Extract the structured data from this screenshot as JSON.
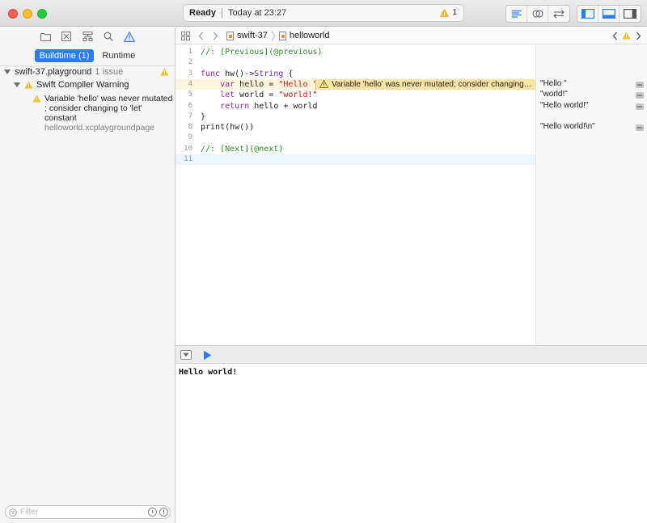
{
  "window": {
    "status": {
      "state": "Ready",
      "time": "Today at 23:27",
      "warning_count": "1"
    },
    "toolbar": {
      "editor_modes": [
        "standard-editor-icon",
        "assistant-editor-icon",
        "version-editor-icon"
      ],
      "view_toggles": [
        "navigator-toggle-icon",
        "debug-area-toggle-icon",
        "utilities-toggle-icon"
      ]
    }
  },
  "navigator": {
    "icons": [
      "folder-icon",
      "symbol-icon",
      "hierarchy-icon",
      "search-icon",
      "issue-warning-icon"
    ],
    "tabs": {
      "buildtime": "Buildtime (1)",
      "runtime": "Runtime"
    },
    "tree": {
      "project": "swift-37.playground",
      "project_count": "1 issue",
      "group": "Swift Compiler Warning",
      "issue_line1": "Variable 'hello' was never mutated",
      "issue_line2": "; consider changing to 'let'",
      "issue_line3": "constant",
      "issue_file": "helloworld.xcplaygroundpage"
    },
    "filter": {
      "placeholder": "Filter"
    }
  },
  "jumpbar": {
    "crumbs": [
      "swift-37",
      "helloworld"
    ]
  },
  "editor": {
    "lines": [
      {
        "n": "1",
        "tokens": [
          {
            "t": "//: [Previous](@previous)",
            "c": "cm"
          }
        ]
      },
      {
        "n": "2",
        "tokens": []
      },
      {
        "n": "3",
        "tokens": [
          {
            "t": "func",
            "c": "kw"
          },
          {
            "t": " hw()->",
            "c": ""
          },
          {
            "t": "String",
            "c": "ty"
          },
          {
            "t": " {",
            "c": ""
          }
        ]
      },
      {
        "n": "4",
        "tokens": [
          {
            "t": "    ",
            "c": ""
          },
          {
            "t": "var",
            "c": "kw"
          },
          {
            "t": " hello = ",
            "c": ""
          },
          {
            "t": "\"Hello \"",
            "c": "str"
          }
        ],
        "warning": true
      },
      {
        "n": "5",
        "tokens": [
          {
            "t": "    ",
            "c": ""
          },
          {
            "t": "let",
            "c": "kw"
          },
          {
            "t": " world = ",
            "c": ""
          },
          {
            "t": "\"world!\"",
            "c": "str"
          }
        ]
      },
      {
        "n": "6",
        "tokens": [
          {
            "t": "    ",
            "c": ""
          },
          {
            "t": "return",
            "c": "kw"
          },
          {
            "t": " hello + world",
            "c": ""
          }
        ]
      },
      {
        "n": "7",
        "tokens": [
          {
            "t": "}",
            "c": ""
          }
        ]
      },
      {
        "n": "8",
        "tokens": [
          {
            "t": "print(hw())",
            "c": ""
          }
        ]
      },
      {
        "n": "9",
        "tokens": []
      },
      {
        "n": "10",
        "tokens": [
          {
            "t": "//: [Next](@next)",
            "c": "cm"
          }
        ]
      },
      {
        "n": "11",
        "tokens": [],
        "current": true
      }
    ],
    "warning_banner": "Variable 'hello' was never mutated; consider changing to 'let' constant"
  },
  "results": [
    {
      "line": 4,
      "text": "\"Hello \""
    },
    {
      "line": 5,
      "text": "\"world!\""
    },
    {
      "line": 6,
      "text": "\"Hello world!\""
    },
    {
      "line": 8,
      "text": "\"Hello world!\\n\""
    }
  ],
  "console": {
    "output": "Hello world!"
  },
  "colors": {
    "accent": "#2d7cf6",
    "warning": "#f5c02c",
    "warning_banner": "#f9e6a5"
  }
}
